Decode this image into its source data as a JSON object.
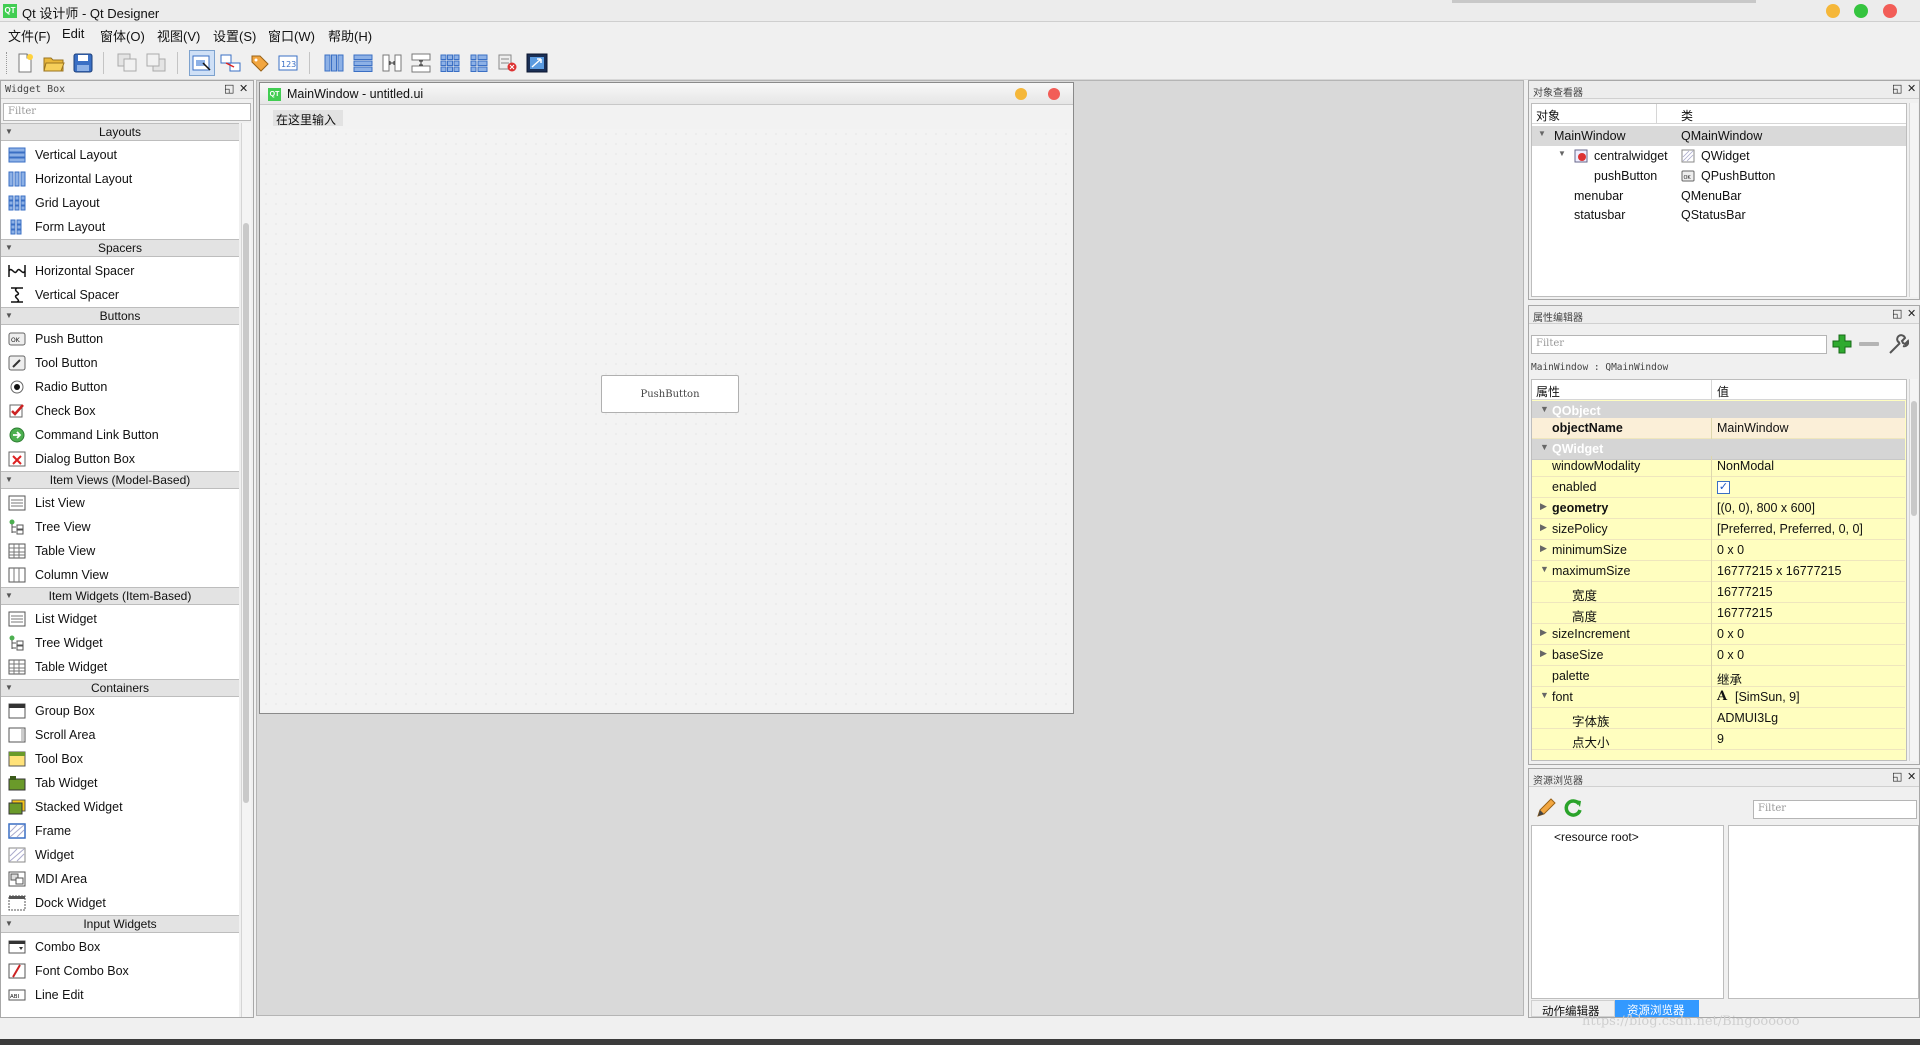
{
  "app": {
    "title": "Qt 设计师 - Qt Designer"
  },
  "menubar": {
    "items": [
      "文件(F)",
      "Edit",
      "窗体(O)",
      "视图(V)",
      "设置(S)",
      "窗口(W)",
      "帮助(H)"
    ]
  },
  "toolbar": {
    "icons": [
      "new-file",
      "open-file",
      "save-file",
      "send-to-back",
      "bring-to-front",
      "edit-widgets",
      "edit-signals-slots",
      "edit-buddies",
      "edit-tab-order",
      "layout-horizontal",
      "layout-vertical",
      "layout-horizontal-splitter",
      "layout-vertical-splitter",
      "layout-grid",
      "layout-form",
      "break-layout",
      "adjust-size"
    ]
  },
  "widget_box": {
    "title": "Widget Box",
    "filter_placeholder": "Filter",
    "sections": [
      {
        "name": "Layouts",
        "items": [
          "Vertical Layout",
          "Horizontal Layout",
          "Grid Layout",
          "Form Layout"
        ]
      },
      {
        "name": "Spacers",
        "items": [
          "Horizontal Spacer",
          "Vertical Spacer"
        ]
      },
      {
        "name": "Buttons",
        "items": [
          "Push Button",
          "Tool Button",
          "Radio Button",
          "Check Box",
          "Command Link Button",
          "Dialog Button Box"
        ]
      },
      {
        "name": "Item Views (Model-Based)",
        "items": [
          "List View",
          "Tree View",
          "Table View",
          "Column View"
        ]
      },
      {
        "name": "Item Widgets (Item-Based)",
        "items": [
          "List Widget",
          "Tree Widget",
          "Table Widget"
        ]
      },
      {
        "name": "Containers",
        "items": [
          "Group Box",
          "Scroll Area",
          "Tool Box",
          "Tab Widget",
          "Stacked Widget",
          "Frame",
          "Widget",
          "MDI Area",
          "Dock Widget"
        ]
      },
      {
        "name": "Input Widgets",
        "items": [
          "Combo Box",
          "Font Combo Box",
          "Line Edit"
        ]
      }
    ]
  },
  "form": {
    "title": "MainWindow - untitled.ui",
    "menu_placeholder": "在这里输入",
    "push_button": "PushButton"
  },
  "object_inspector": {
    "title": "对象查看器",
    "headers": [
      "对象",
      "类"
    ],
    "rows": [
      {
        "object": "MainWindow",
        "class": "QMainWindow"
      },
      {
        "object": "centralwidget",
        "class": "QWidget"
      },
      {
        "object": "pushButton",
        "class": "QPushButton"
      },
      {
        "object": "menubar",
        "class": "QMenuBar"
      },
      {
        "object": "statusbar",
        "class": "QStatusBar"
      }
    ]
  },
  "property_editor": {
    "title": "属性编辑器",
    "filter_placeholder": "Filter",
    "context": "MainWindow : QMainWindow",
    "headers": [
      "属性",
      "值"
    ],
    "rows": [
      {
        "name": "QObject",
        "value": "",
        "kind": "group"
      },
      {
        "name": "objectName",
        "value": "MainWindow",
        "kind": "bold"
      },
      {
        "name": "QWidget",
        "value": "",
        "kind": "group"
      },
      {
        "name": "windowModality",
        "value": "NonModal",
        "kind": "normal"
      },
      {
        "name": "enabled",
        "value": "",
        "kind": "checkbox"
      },
      {
        "name": "geometry",
        "value": "[(0, 0), 800 x 600]",
        "kind": "bold-collapsed"
      },
      {
        "name": "sizePolicy",
        "value": "[Preferred, Preferred, 0, 0]",
        "kind": "collapsed"
      },
      {
        "name": "minimumSize",
        "value": "0 x 0",
        "kind": "collapsed"
      },
      {
        "name": "maximumSize",
        "value": "16777215 x 16777215",
        "kind": "expanded"
      },
      {
        "name": "宽度",
        "value": "16777215",
        "kind": "child"
      },
      {
        "name": "高度",
        "value": "16777215",
        "kind": "child"
      },
      {
        "name": "sizeIncrement",
        "value": "0 x 0",
        "kind": "collapsed"
      },
      {
        "name": "baseSize",
        "value": "0 x 0",
        "kind": "collapsed"
      },
      {
        "name": "palette",
        "value": "继承",
        "kind": "normal"
      },
      {
        "name": "font",
        "value": "[SimSun, 9]",
        "kind": "expanded-font"
      },
      {
        "name": "字体族",
        "value": "ADMUI3Lg",
        "kind": "child"
      },
      {
        "name": "点大小",
        "value": "9",
        "kind": "child"
      }
    ]
  },
  "resource_browser": {
    "title": "资源浏览器",
    "filter_placeholder": "Filter",
    "root": "<resource root>"
  },
  "bottom_tabs": [
    "动作编辑器",
    "资源浏览器"
  ],
  "watermark": "https://blog.csdn.net/Bingoooooo",
  "colors": {
    "accent": "#3399ff",
    "property_bg": "#fffebf",
    "group_bg": "#d5d5d5",
    "qt_green": "#41cd52"
  }
}
